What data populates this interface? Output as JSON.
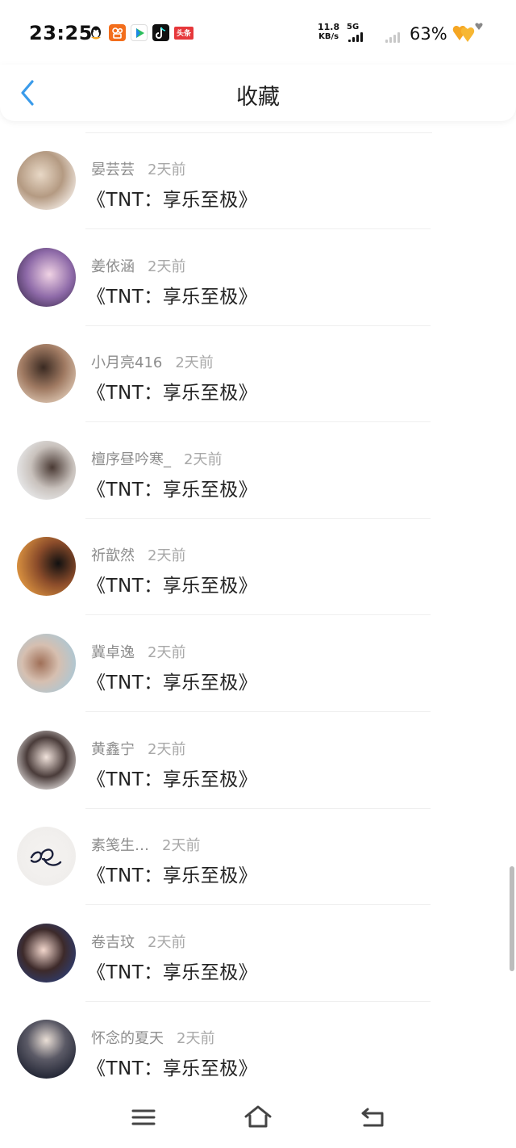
{
  "status_bar": {
    "time": "23:25",
    "net_speed_value": "11.8",
    "net_speed_unit": "KB/s",
    "network_type": "5G",
    "battery": "63%",
    "notification_icons": [
      "qq-icon",
      "kuaishou-icon",
      "video-icon",
      "tiktok-icon"
    ],
    "toutiao_label": "头条"
  },
  "header": {
    "back_icon": "chevron-left-icon",
    "title": "收藏",
    "accent_color": "#3a9bea"
  },
  "items": [
    {
      "name": "晏芸芸",
      "time": "2天前",
      "title": "《TNT：享乐至极》"
    },
    {
      "name": "姜依涵",
      "time": "2天前",
      "title": "《TNT：享乐至极》"
    },
    {
      "name": "小月亮416",
      "time": "2天前",
      "title": "《TNT：享乐至极》"
    },
    {
      "name": "檀序昼吟寒_",
      "time": "2天前",
      "title": "《TNT：享乐至极》"
    },
    {
      "name": "祈歆然",
      "time": "2天前",
      "title": "《TNT：享乐至极》"
    },
    {
      "name": "冀卓逸",
      "time": "2天前",
      "title": "《TNT：享乐至极》"
    },
    {
      "name": "黄鑫宁",
      "time": "2天前",
      "title": "《TNT：享乐至极》"
    },
    {
      "name": "素笺生…",
      "time": "2天前",
      "title": "《TNT：享乐至极》"
    },
    {
      "name": "卷吉玟",
      "time": "2天前",
      "title": "《TNT：享乐至极》"
    },
    {
      "name": "怀念的夏天",
      "time": "2天前",
      "title": "《TNT：享乐至极》"
    }
  ],
  "bottom_nav": {
    "buttons": [
      "menu-icon",
      "home-icon",
      "back-icon"
    ]
  }
}
